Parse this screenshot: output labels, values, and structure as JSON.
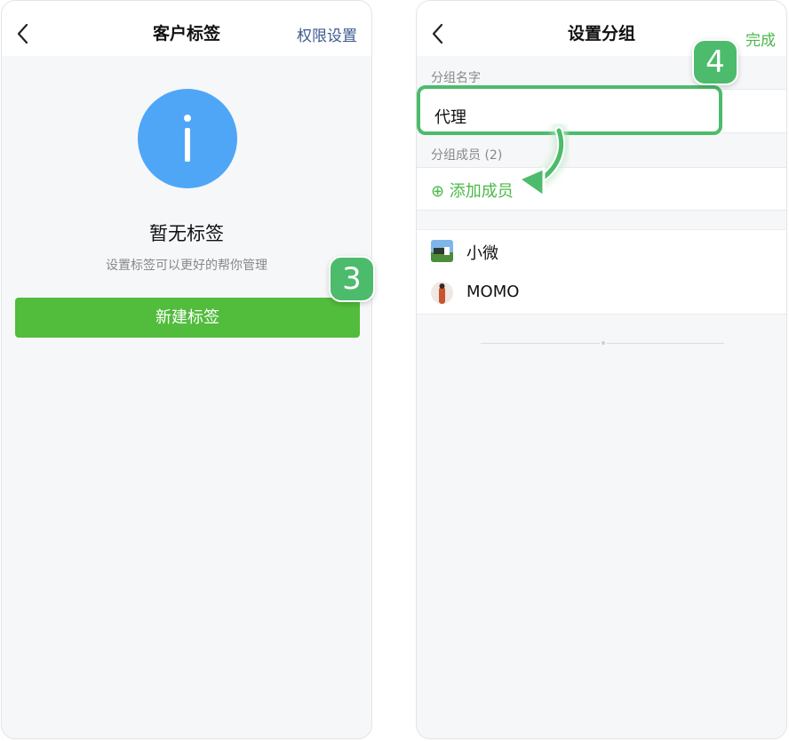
{
  "left": {
    "title": "客户标签",
    "action": "权限设置",
    "empty_title": "暂无标签",
    "empty_subtitle": "设置标签可以更好的帮你管理",
    "button": "新建标签",
    "step": "3"
  },
  "right": {
    "title": "设置分组",
    "action": "完成",
    "group_name_label": "分组名字",
    "group_name_value": "代理",
    "members_label": "分组成员 (2)",
    "add_member": "⊕ 添加成员",
    "step": "4",
    "members": [
      {
        "name": "小微"
      },
      {
        "name": "MOMO"
      }
    ]
  },
  "colors": {
    "accent_green": "#52bc3c",
    "badge_green": "#4dbb6c",
    "info_blue": "#4fa6f7",
    "link_blue": "#3d5a8f"
  }
}
